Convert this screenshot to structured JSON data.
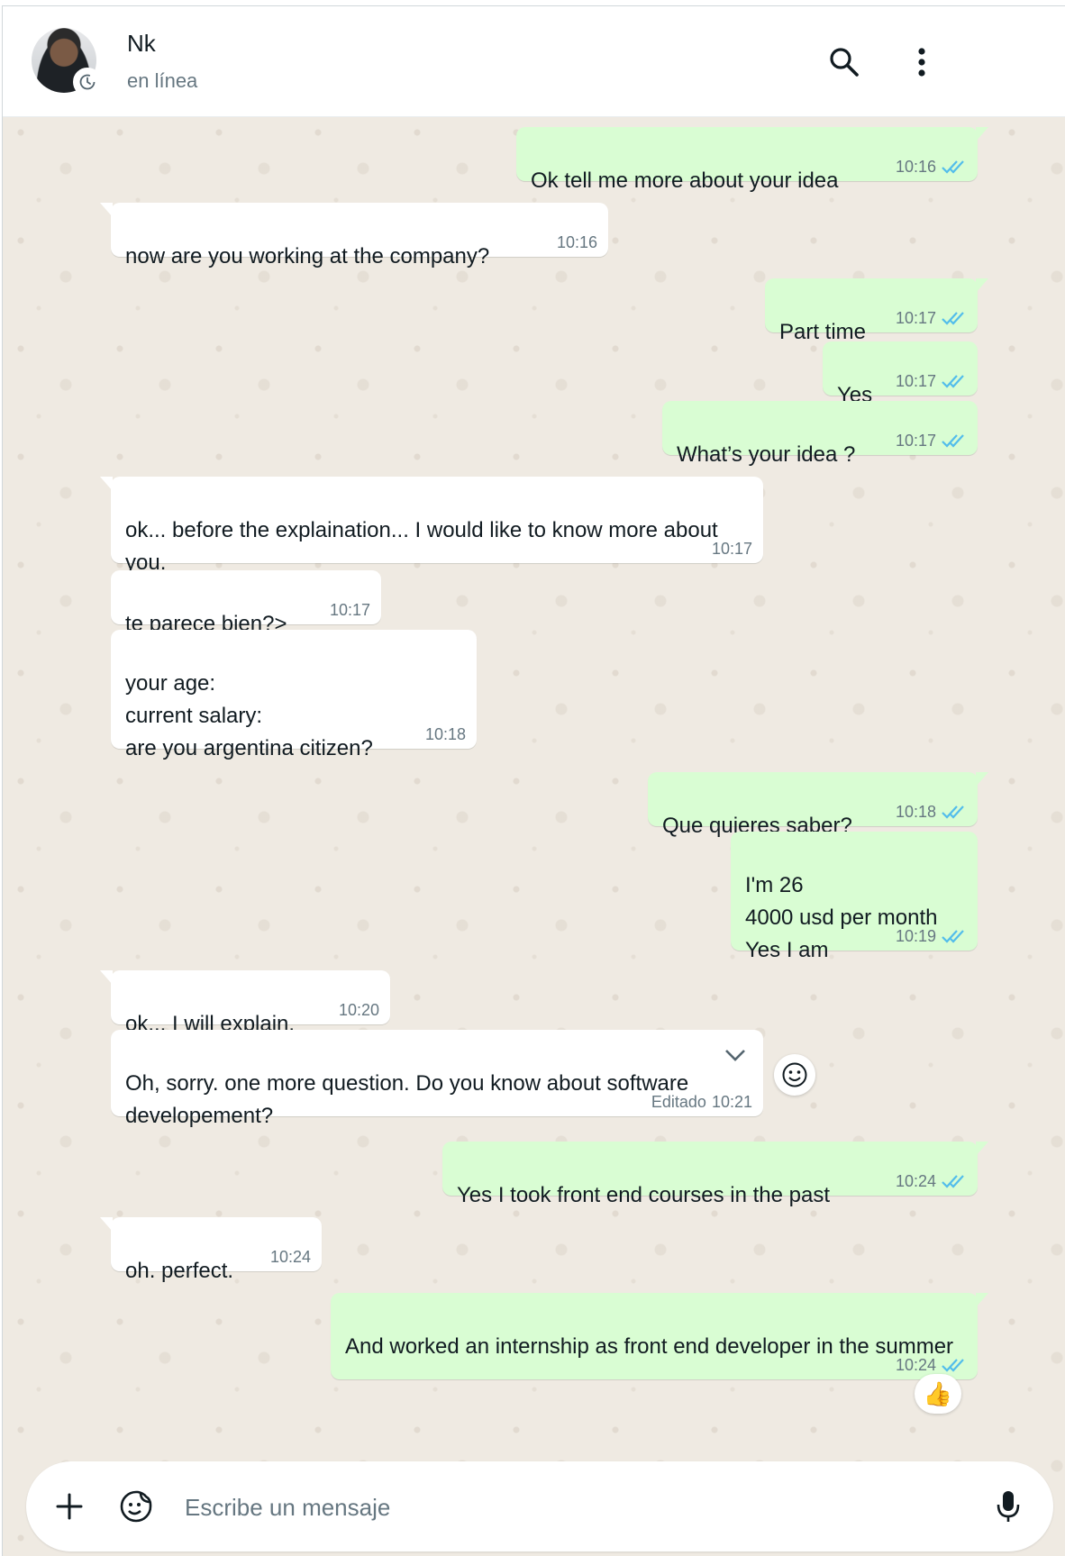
{
  "header": {
    "name": "Nk",
    "status": "en línea"
  },
  "messages": [
    {
      "dir": "out",
      "text": "Ok tell me more about your idea",
      "time": "10:16",
      "read": true
    },
    {
      "dir": "in",
      "text": "now are you working at the company?",
      "time": "10:16"
    },
    {
      "dir": "out",
      "text": "Part time",
      "time": "10:17",
      "read": true
    },
    {
      "dir": "out",
      "text": "Yes",
      "time": "10:17",
      "read": true
    },
    {
      "dir": "out",
      "text": "What’s your idea ?",
      "time": "10:17",
      "read": true
    },
    {
      "dir": "in",
      "text": "ok... before the explaination... I would like to know more about you.",
      "time": "10:17"
    },
    {
      "dir": "in",
      "text": "te parece bien?>",
      "time": "10:17"
    },
    {
      "dir": "in",
      "text": "your age:\ncurrent salary:\nare you argentina citizen?",
      "time": "10:18"
    },
    {
      "dir": "out",
      "text": "Que quieres saber?",
      "time": "10:18",
      "read": true
    },
    {
      "dir": "out",
      "text": "I'm 26\n4000 usd per month\nYes I am",
      "time": "10:19",
      "read": true
    },
    {
      "dir": "in",
      "text": "ok... I will explain.",
      "time": "10:20"
    },
    {
      "dir": "in",
      "text": "Oh, sorry. one more question. Do you know about software developement?",
      "time": "10:21",
      "edited": "Editado"
    },
    {
      "dir": "out",
      "text": "Yes I took front end courses in the past",
      "time": "10:24",
      "read": true
    },
    {
      "dir": "in",
      "text": "oh. perfect.",
      "time": "10:24"
    },
    {
      "dir": "out",
      "text": "And worked an internship as front end developer in the summer",
      "time": "10:24",
      "read": true,
      "reaction": "👍"
    }
  ],
  "composer": {
    "placeholder": "Escribe un mensaje"
  },
  "icons": {
    "search": "search-icon",
    "menu": "kebab-menu-icon",
    "attach": "plus-icon",
    "sticker": "sticker-icon",
    "mic": "mic-icon",
    "read": "double-check-icon",
    "chevron": "chevron-down-icon",
    "react": "smiley-icon"
  },
  "colors": {
    "outgoing": "#d9fdd3",
    "incoming": "#ffffff",
    "background": "#efeae2",
    "read_tick": "#53bdeb",
    "meta_text": "#667781"
  }
}
